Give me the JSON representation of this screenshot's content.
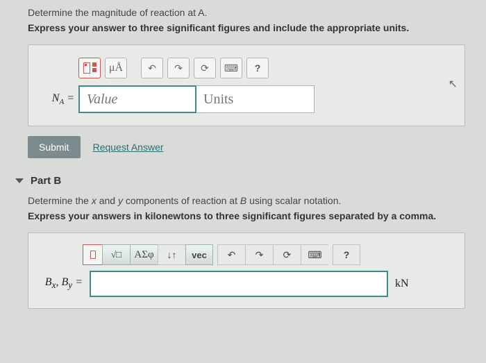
{
  "partA": {
    "question": "Determine the magnitude of reaction at A.",
    "instruction": "Express your answer to three significant figures and include the appropriate units.",
    "toolbar": {
      "mu": "μÅ",
      "help": "?"
    },
    "eqLabel": "N",
    "eqSub": "A",
    "eqSign": " =",
    "valuePlaceholder": "Value",
    "unitsPlaceholder": "Units",
    "submit": "Submit",
    "requestAnswer": "Request Answer"
  },
  "partB": {
    "label": "Part B",
    "question": "Determine the x and y components of reaction at B using scalar notation.",
    "instruction": "Express your answers in kilonewtons to three significant figures separated by a comma.",
    "toolbar": {
      "sigma": "ΑΣφ",
      "arrows": "↓↑",
      "vec": "vec",
      "help": "?"
    },
    "eqPrefix": "B",
    "eqSubX": "x",
    "eqComma": ", ",
    "eqSubY": "y",
    "eqSign": " =",
    "unit": "kN"
  }
}
